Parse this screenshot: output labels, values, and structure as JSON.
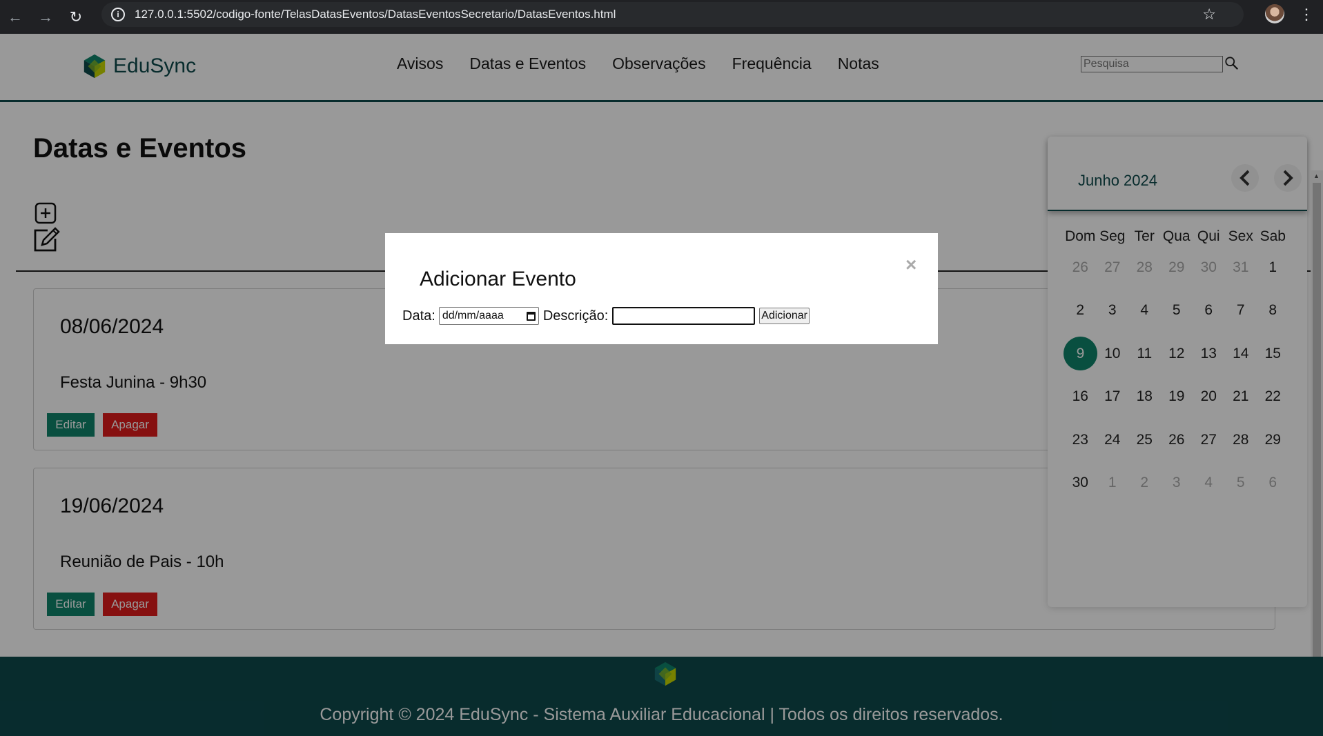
{
  "browser": {
    "url": "127.0.0.1:5502/codigo-fonte/TelasDatasEventos/DatasEventosSecretario/DatasEventos.html"
  },
  "header": {
    "brand": "EduSync",
    "nav": [
      "Avisos",
      "Datas e Eventos",
      "Observações",
      "Frequência",
      "Notas"
    ],
    "search_placeholder": "Pesquisa"
  },
  "page": {
    "title": "Datas e Eventos"
  },
  "events": [
    {
      "date": "08/06/2024",
      "description": "Festa Junina - 9h30",
      "edit_label": "Editar",
      "delete_label": "Apagar"
    },
    {
      "date": "19/06/2024",
      "description": "Reunião de Pais - 10h",
      "edit_label": "Editar",
      "delete_label": "Apagar"
    }
  ],
  "calendar": {
    "month_label": "Junho 2024",
    "weekdays": [
      "Dom",
      "Seg",
      "Ter",
      "Qua",
      "Qui",
      "Sex",
      "Sab"
    ],
    "weeks": [
      [
        "26",
        "27",
        "28",
        "29",
        "30",
        "31",
        "1"
      ],
      [
        "2",
        "3",
        "4",
        "5",
        "6",
        "7",
        "8"
      ],
      [
        "9",
        "10",
        "11",
        "12",
        "13",
        "14",
        "15"
      ],
      [
        "16",
        "17",
        "18",
        "19",
        "20",
        "21",
        "22"
      ],
      [
        "23",
        "24",
        "25",
        "26",
        "27",
        "28",
        "29"
      ],
      [
        "30",
        "1",
        "2",
        "3",
        "4",
        "5",
        "6"
      ]
    ],
    "today": "9"
  },
  "modal": {
    "title": "Adicionar Evento",
    "close_symbol": "×",
    "date_label": "Data:",
    "date_placeholder": "dd/mm/aaaa",
    "description_label": "Descrição:",
    "description_value": "",
    "submit_label": "Adicionar"
  },
  "footer": {
    "copyright": "Copyright © 2024 EduSync - Sistema Auxiliar Educacional | Todos os direitos reservados."
  },
  "colors": {
    "brand_dark": "#0e4a4c",
    "accent_green": "#10846b",
    "danger_red": "#e01b1b"
  }
}
